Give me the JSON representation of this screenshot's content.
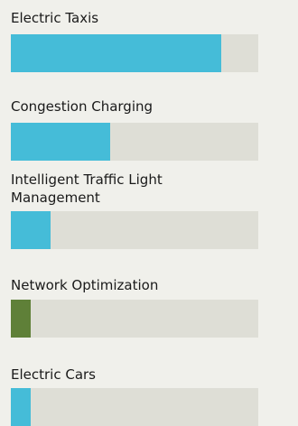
{
  "chart_data": {
    "type": "bar",
    "orientation": "horizontal",
    "xlim": [
      0,
      100
    ],
    "grid": false,
    "categories": [
      "Electric Taxis",
      "Congestion Charging",
      "Intelligent Traffic Light Management",
      "Network Optimization",
      "Electric Cars"
    ],
    "values": [
      85,
      40,
      16,
      8,
      8
    ],
    "colors": [
      "#45bcd8",
      "#45bcd8",
      "#45bcd8",
      "#5f8038",
      "#45bcd8"
    ]
  }
}
